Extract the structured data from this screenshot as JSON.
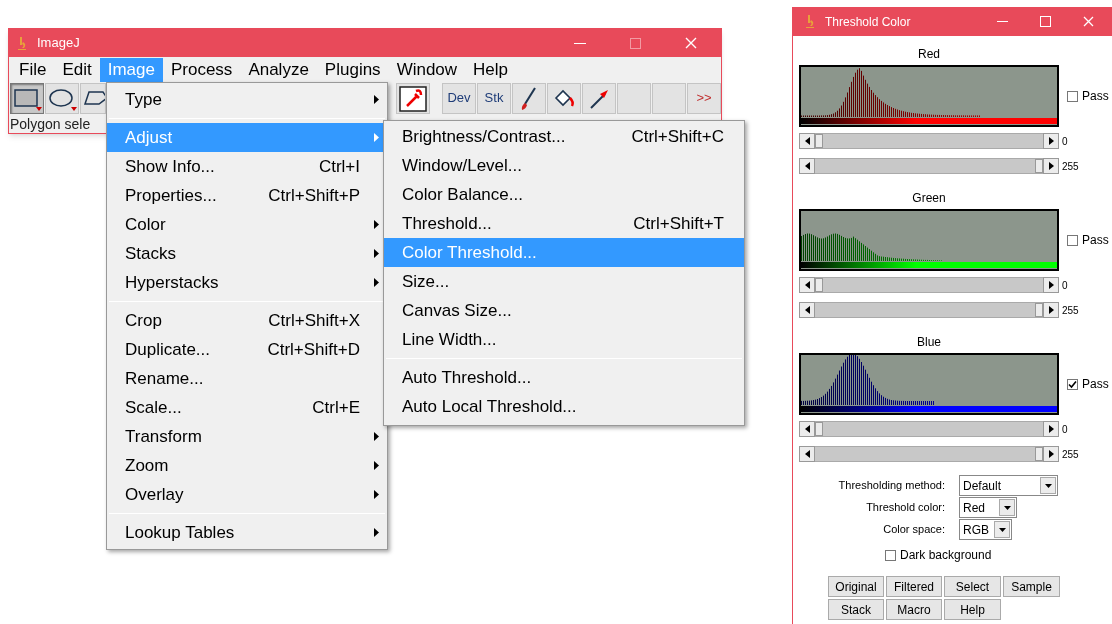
{
  "imagej_window": {
    "title": "ImageJ",
    "menu_bar": [
      {
        "label": "File",
        "selected": false
      },
      {
        "label": "Edit",
        "selected": false
      },
      {
        "label": "Image",
        "selected": true
      },
      {
        "label": "Process",
        "selected": false
      },
      {
        "label": "Analyze",
        "selected": false
      },
      {
        "label": "Plugins",
        "selected": false
      },
      {
        "label": "Window",
        "selected": false
      },
      {
        "label": "Help",
        "selected": false
      }
    ],
    "toolbar": [
      {
        "kind": "rectangle",
        "selected": true
      },
      {
        "kind": "oval",
        "selected": false
      },
      {
        "kind": "polygon",
        "selected": false
      },
      {
        "kind": "eyedropper",
        "selected": false
      },
      {
        "kind": "text",
        "label": "Dev",
        "selected": false
      },
      {
        "kind": "text",
        "label": "Stk",
        "selected": false
      },
      {
        "kind": "brush",
        "selected": false
      },
      {
        "kind": "fill",
        "selected": false
      },
      {
        "kind": "arrow",
        "selected": false
      },
      {
        "kind": "empty",
        "selected": false
      },
      {
        "kind": "empty",
        "selected": false
      },
      {
        "kind": "more",
        "label": ">>",
        "selected": false
      }
    ],
    "status_text": "Polygon sele"
  },
  "image_menu": [
    {
      "kind": "item",
      "label": "Type",
      "has_submenu": true,
      "selected": false
    },
    {
      "kind": "separator"
    },
    {
      "kind": "item",
      "label": "Adjust",
      "has_submenu": true,
      "selected": true
    },
    {
      "kind": "item",
      "label": "Show Info...",
      "shortcut": "Ctrl+I",
      "has_submenu": false,
      "selected": false
    },
    {
      "kind": "item",
      "label": "Properties...",
      "shortcut": "Ctrl+Shift+P",
      "has_submenu": false,
      "selected": false
    },
    {
      "kind": "item",
      "label": "Color",
      "has_submenu": true,
      "selected": false
    },
    {
      "kind": "item",
      "label": "Stacks",
      "has_submenu": true,
      "selected": false
    },
    {
      "kind": "item",
      "label": "Hyperstacks",
      "has_submenu": true,
      "selected": false
    },
    {
      "kind": "separator"
    },
    {
      "kind": "item",
      "label": "Crop",
      "shortcut": "Ctrl+Shift+X",
      "has_submenu": false,
      "selected": false
    },
    {
      "kind": "item",
      "label": "Duplicate...",
      "shortcut": "Ctrl+Shift+D",
      "has_submenu": false,
      "selected": false
    },
    {
      "kind": "item",
      "label": "Rename...",
      "has_submenu": false,
      "selected": false
    },
    {
      "kind": "item",
      "label": "Scale...",
      "shortcut": "Ctrl+E",
      "has_submenu": false,
      "selected": false
    },
    {
      "kind": "item",
      "label": "Transform",
      "has_submenu": true,
      "selected": false
    },
    {
      "kind": "item",
      "label": "Zoom",
      "has_submenu": true,
      "selected": false
    },
    {
      "kind": "item",
      "label": "Overlay",
      "has_submenu": true,
      "selected": false
    },
    {
      "kind": "separator"
    },
    {
      "kind": "item",
      "label": "Lookup Tables",
      "has_submenu": true,
      "selected": false
    }
  ],
  "adjust_submenu": [
    {
      "kind": "item",
      "label": "Brightness/Contrast...",
      "shortcut": "Ctrl+Shift+C",
      "selected": false
    },
    {
      "kind": "item",
      "label": "Window/Level...",
      "selected": false
    },
    {
      "kind": "item",
      "label": "Color Balance...",
      "selected": false
    },
    {
      "kind": "item",
      "label": "Threshold...",
      "shortcut": "Ctrl+Shift+T",
      "selected": false
    },
    {
      "kind": "item",
      "label": "Color Threshold...",
      "selected": true
    },
    {
      "kind": "item",
      "label": "Size...",
      "selected": false
    },
    {
      "kind": "item",
      "label": "Canvas Size...",
      "selected": false
    },
    {
      "kind": "item",
      "label": "Line Width...",
      "selected": false
    },
    {
      "kind": "separator"
    },
    {
      "kind": "item",
      "label": "Auto Threshold...",
      "selected": false
    },
    {
      "kind": "item",
      "label": "Auto Local Threshold...",
      "selected": false
    }
  ],
  "threshold_window": {
    "title": "Threshold Color",
    "channels": [
      {
        "name": "Red",
        "color": "#ff0000",
        "pass_label": "Pass",
        "pass": false,
        "sliders": [
          {
            "level": 0,
            "reading": "0"
          },
          {
            "level": 1,
            "reading": "255"
          }
        ]
      },
      {
        "name": "Green",
        "color": "#00ff00",
        "pass_label": "Pass",
        "pass": false,
        "sliders": [
          {
            "level": 0,
            "reading": "0"
          },
          {
            "level": 1,
            "reading": "255"
          }
        ]
      },
      {
        "name": "Blue",
        "color": "#0000ff",
        "pass_label": "Pass",
        "pass": true,
        "sliders": [
          {
            "level": 0,
            "reading": "0"
          },
          {
            "level": 1,
            "reading": "255"
          }
        ]
      }
    ],
    "options": [
      {
        "label": "Thresholding method:",
        "value": "Default"
      },
      {
        "label": "Threshold color:",
        "value": "Red"
      },
      {
        "label": "Color space:",
        "value": "RGB"
      }
    ],
    "dark_background": {
      "label": "Dark background",
      "checked": false
    },
    "buttons": [
      "Original",
      "Filtered",
      "Select",
      "Sample",
      "Stack",
      "Macro",
      "Help"
    ]
  }
}
